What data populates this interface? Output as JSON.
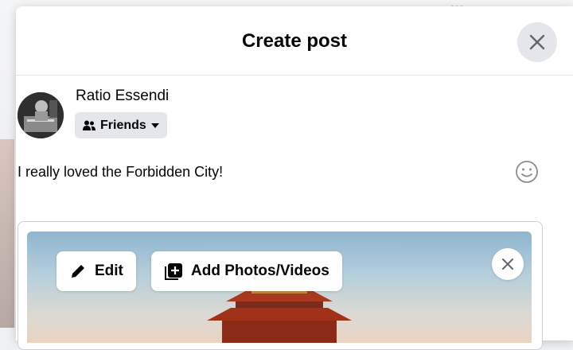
{
  "dialog": {
    "title": "Create post"
  },
  "author": {
    "name": "Ratio Essendi",
    "audience_label": "Friends"
  },
  "composer": {
    "text": "I really loved the Forbidden City!"
  },
  "attachment": {
    "edit_label": "Edit",
    "add_label": "Add Photos/Videos"
  },
  "colors": {
    "surface": "#ffffff",
    "control_bg": "#e4e6eb",
    "text": "#050505",
    "border": "#ced0d4"
  },
  "icons": [
    "close-icon",
    "friends-icon",
    "caret-down-icon",
    "emoji-icon",
    "pencil-icon",
    "add-photo-icon",
    "remove-icon"
  ]
}
